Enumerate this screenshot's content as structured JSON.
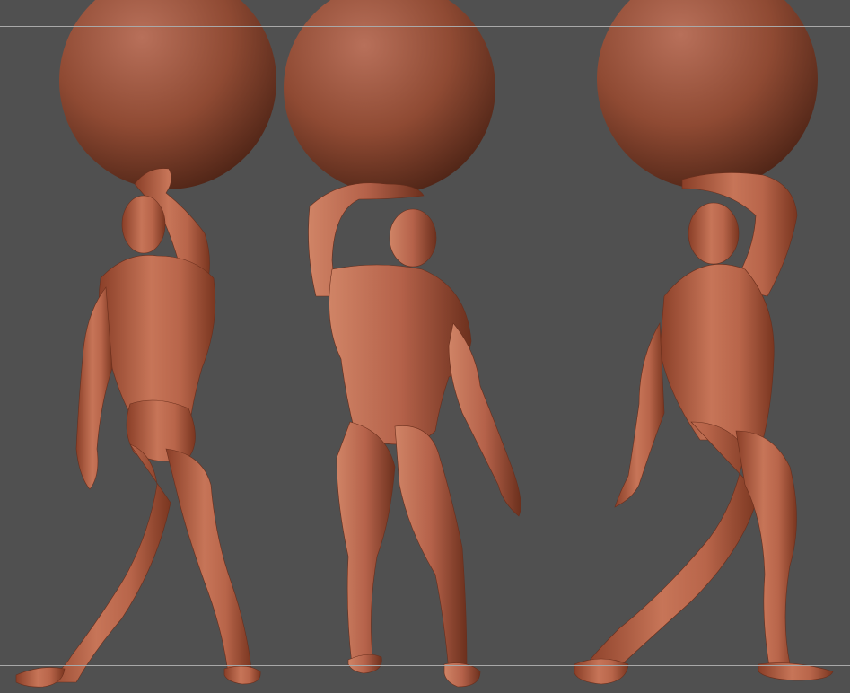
{
  "scene": {
    "background_color": "#505050",
    "guide_line_color": "#a9a9a9",
    "clay_color": "#b8654a",
    "clay_shadow": "#6e3220",
    "clay_highlight": "#d7876a",
    "figures": [
      {
        "view": "back",
        "prop": "sphere",
        "icon": "figure-back-icon"
      },
      {
        "view": "front",
        "prop": "sphere",
        "icon": "figure-front-icon"
      },
      {
        "view": "side",
        "prop": "sphere",
        "icon": "figure-side-icon"
      }
    ]
  }
}
